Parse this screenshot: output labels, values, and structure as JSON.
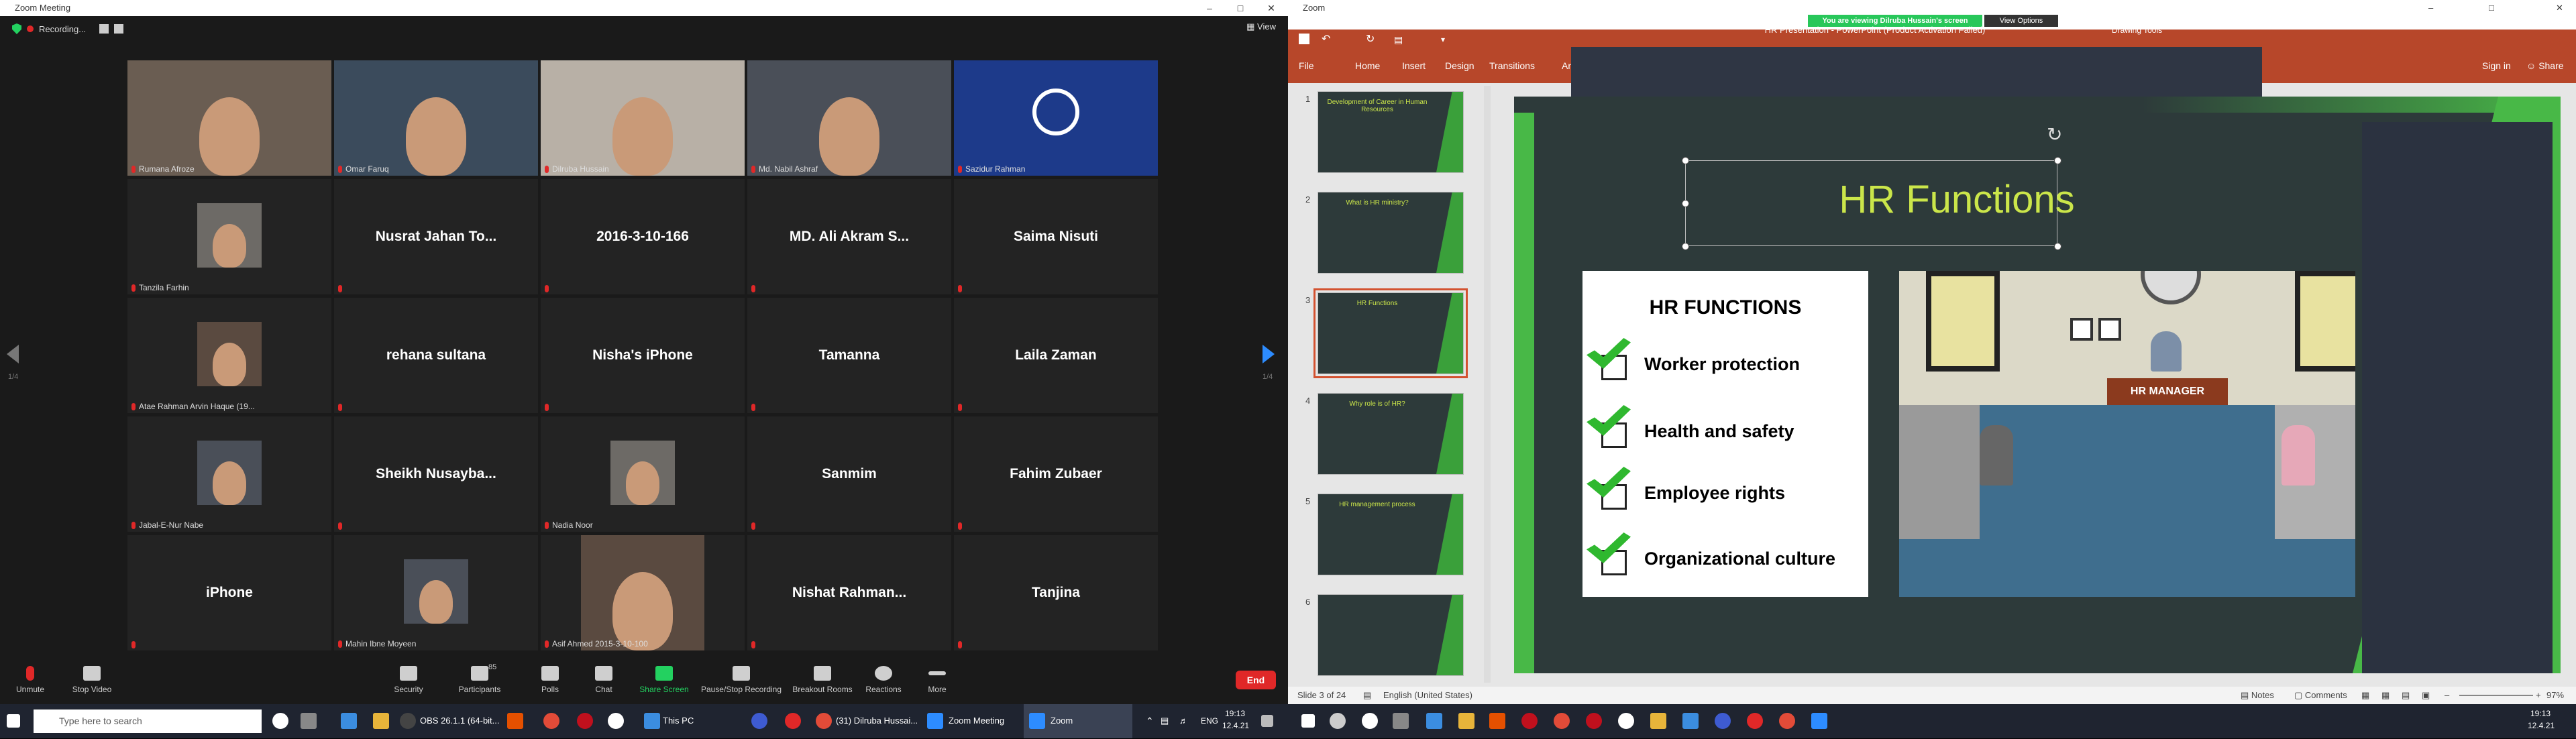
{
  "left_window": {
    "title": "Zoom Meeting",
    "recording_label": "Recording...",
    "view_label": "View",
    "page_indicator_left": "1/4",
    "page_indicator_right": "1/4",
    "participants": [
      {
        "label": "Rumana Afroze",
        "big_name": "",
        "video": true,
        "active": false
      },
      {
        "label": "Omar Faruq",
        "big_name": "",
        "video": true,
        "active": false
      },
      {
        "label": "Dilruba Hussain",
        "big_name": "",
        "video": true,
        "active": true
      },
      {
        "label": "Md. Nabil Ashraf",
        "big_name": "",
        "video": true,
        "active": false
      },
      {
        "label": "Sazidur Rahman",
        "big_name": "",
        "video": true,
        "active": false
      },
      {
        "label": "Tanzila Farhin",
        "big_name": "",
        "video": true,
        "active": false
      },
      {
        "label": "",
        "big_name": "Nusrat Jahan To...",
        "video": false,
        "active": false
      },
      {
        "label": "",
        "big_name": "2016-3-10-166",
        "video": false,
        "active": false
      },
      {
        "label": "",
        "big_name": "MD. Ali Akram S...",
        "video": false,
        "active": false
      },
      {
        "label": "",
        "big_name": "Saima Nisuti",
        "video": false,
        "active": false
      },
      {
        "label": "Atae Rahman Arvin Haque (19...",
        "big_name": "",
        "video": true,
        "active": false
      },
      {
        "label": "",
        "big_name": "rehana sultana",
        "video": false,
        "active": false
      },
      {
        "label": "",
        "big_name": "Nisha's iPhone",
        "video": false,
        "active": false
      },
      {
        "label": "",
        "big_name": "Tamanna",
        "video": false,
        "active": false
      },
      {
        "label": "",
        "big_name": "Laila Zaman",
        "video": false,
        "active": false
      },
      {
        "label": "Jabal-E-Nur Nabe",
        "big_name": "",
        "video": true,
        "active": false
      },
      {
        "label": "",
        "big_name": "Sheikh  Nusayba...",
        "video": false,
        "active": false
      },
      {
        "label": "Nadia Noor",
        "big_name": "",
        "video": true,
        "active": false
      },
      {
        "label": "",
        "big_name": "Sanmim",
        "video": false,
        "active": false
      },
      {
        "label": "",
        "big_name": "Fahim Zubaer",
        "video": false,
        "active": false
      },
      {
        "label": "",
        "big_name": "iPhone",
        "video": false,
        "active": false
      },
      {
        "label": "Mahin Ibne Moyeen",
        "big_name": "",
        "video": true,
        "active": false
      },
      {
        "label": "Asif Ahmed 2015-3-10-100",
        "big_name": "",
        "video": true,
        "active": false
      },
      {
        "label": "",
        "big_name": "Nishat  Rahman...",
        "video": false,
        "active": false
      },
      {
        "label": "",
        "big_name": "Tanjina",
        "video": false,
        "active": false
      }
    ],
    "toolbar": {
      "unmute": "Unmute",
      "stop_video": "Stop Video",
      "security": "Security",
      "participants": "Participants",
      "participants_count": "85",
      "polls": "Polls",
      "chat": "Chat",
      "share_screen": "Share Screen",
      "pause_recording": "Pause/Stop Recording",
      "breakout": "Breakout Rooms",
      "reactions": "Reactions",
      "more": "More",
      "end": "End"
    }
  },
  "left_taskbar": {
    "search_placeholder": "Type here to search",
    "items": [
      "OBS 26.1.1 (64-bit...",
      "This PC",
      "(31) Dilruba Hussai...",
      "Zoom Meeting",
      "Zoom"
    ],
    "lang": "ENG",
    "time": "19:13",
    "date": "12.4.21"
  },
  "right_window": {
    "zoom_title": "Zoom",
    "viewing_notice": "You are viewing Dilruba Hussain's screen",
    "view_options": "View Options",
    "ppt_title": "HR Presentation - PowerPoint (Product Activation Failed)",
    "drawing_tools": "Drawing Tools",
    "sign_in": "Sign in",
    "share": "Share",
    "ribbon_tabs": [
      "File",
      "Home",
      "Insert",
      "Design",
      "Transitions",
      "An"
    ],
    "thumbnails": [
      {
        "num": "1",
        "title": "Development of Career in Human Resources"
      },
      {
        "num": "2",
        "title": "What is HR ministry?"
      },
      {
        "num": "3",
        "title": "HR Functions"
      },
      {
        "num": "4",
        "title": "Why role is of HR?"
      },
      {
        "num": "5",
        "title": "HR management process"
      },
      {
        "num": "6",
        "title": ""
      }
    ],
    "slide": {
      "title": "HR Functions",
      "card_heading": "HR FUNCTIONS",
      "items": [
        "Worker protection",
        "Health and safety",
        "Employee rights",
        "Organizational culture"
      ],
      "manager_sign": "HR MANAGER"
    },
    "status": {
      "slide_of": "Slide 3 of 24",
      "language": "English (United States)",
      "notes": "Notes",
      "comments": "Comments",
      "zoom": "97%"
    }
  },
  "right_taskbar": {
    "time": "19:13",
    "date": "12.4.21"
  }
}
